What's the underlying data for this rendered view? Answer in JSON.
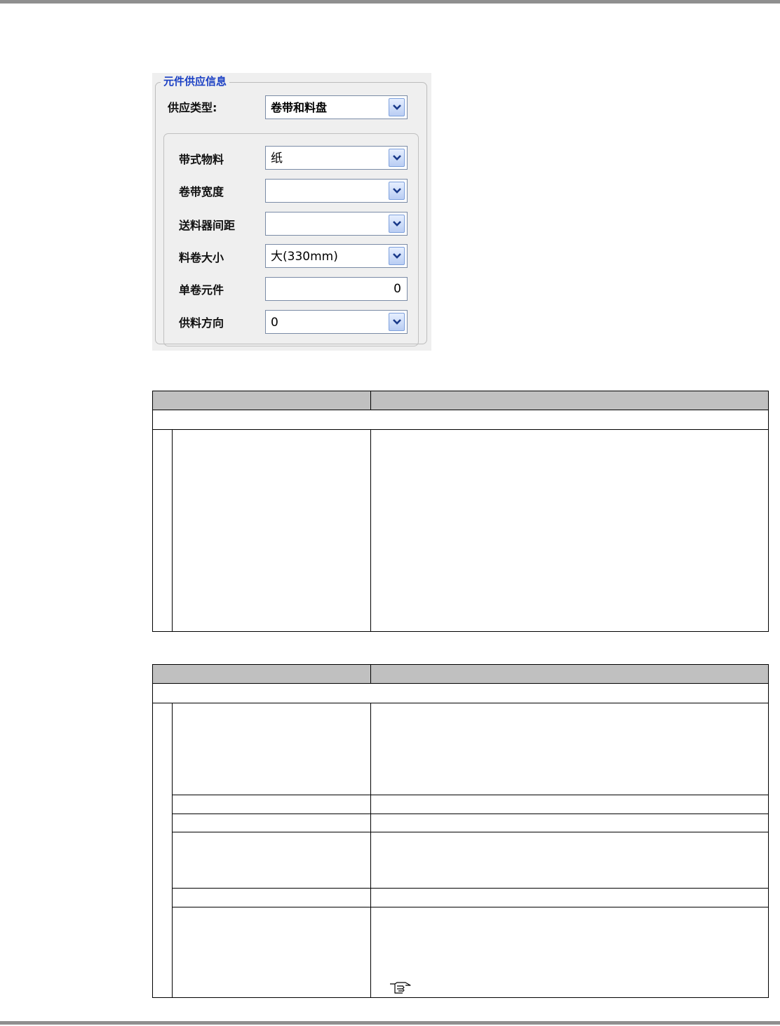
{
  "panel": {
    "group_title": "元件供应信息",
    "supply_type_label": "供应类型:",
    "supply_type_value": "卷带和料盘",
    "fields": [
      {
        "label": "带式物料",
        "value": "纸",
        "kind": "combo"
      },
      {
        "label": "卷带宽度",
        "value": "",
        "kind": "combo"
      },
      {
        "label": "送料器间距",
        "value": "",
        "kind": "combo"
      },
      {
        "label": "料卷大小",
        "value": "大(330mm)",
        "kind": "combo"
      },
      {
        "label": "单卷元件",
        "value": "0",
        "kind": "text"
      },
      {
        "label": "供料方向",
        "value": "0",
        "kind": "combo"
      }
    ]
  },
  "icons": {
    "dropdown": "chevron-down-icon",
    "reference": "pointing-hand-icon"
  }
}
